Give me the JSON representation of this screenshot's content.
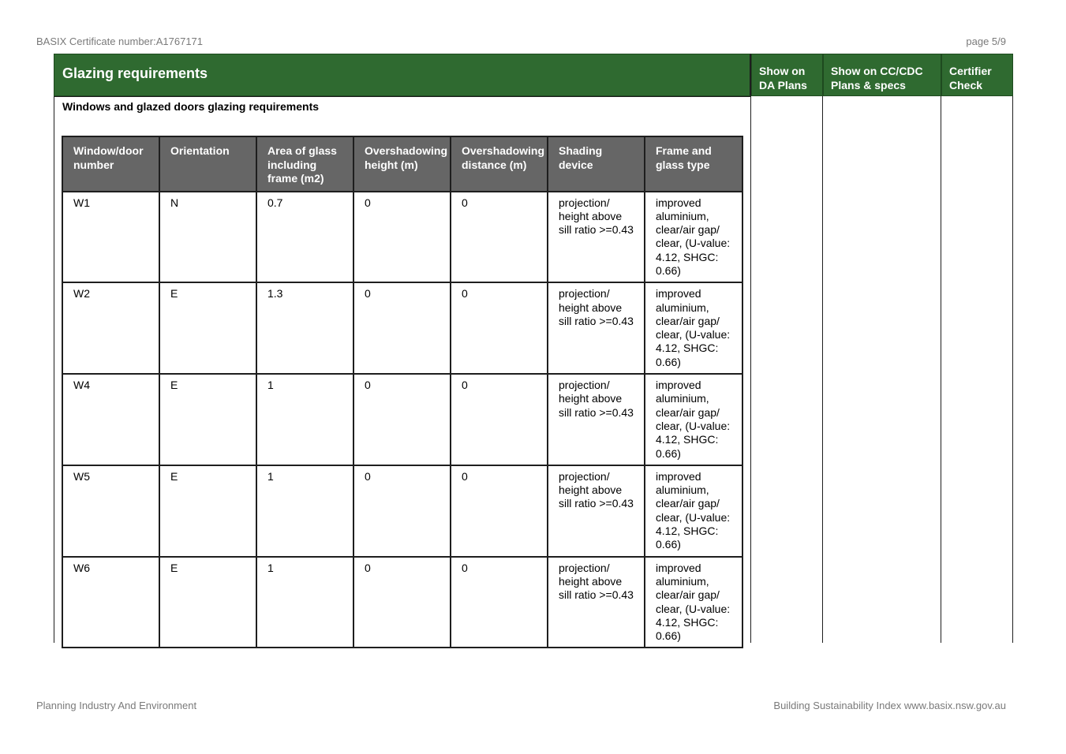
{
  "header": {
    "certificate": "BASIX Certificate number:A1767171",
    "page": "page 5/9"
  },
  "section": {
    "title": "Glazing requirements",
    "columns": [
      "Show on\nDA Plans",
      "Show on CC/CDC\nPlans & specs",
      "Certifier\nCheck"
    ],
    "subtitle": "Windows and glazed doors glazing requirements"
  },
  "table": {
    "headers": [
      "Window/door number",
      "Orientation",
      "Area of glass including frame (m2)",
      "Overshadowing height (m)",
      "Overshadowing distance (m)",
      "Shading device",
      "Frame and glass type"
    ],
    "rows": [
      [
        "W1",
        "N",
        "0.7",
        "0",
        "0",
        "projection/ height above sill ratio >=0.43",
        "improved aluminium, clear/air gap/ clear, (U-value: 4.12, SHGC: 0.66)"
      ],
      [
        "W2",
        "E",
        "1.3",
        "0",
        "0",
        "projection/ height above sill ratio >=0.43",
        "improved aluminium, clear/air gap/ clear, (U-value: 4.12, SHGC: 0.66)"
      ],
      [
        "W4",
        "E",
        "1",
        "0",
        "0",
        "projection/ height above sill ratio >=0.43",
        "improved aluminium, clear/air gap/ clear, (U-value: 4.12, SHGC: 0.66)"
      ],
      [
        "W5",
        "E",
        "1",
        "0",
        "0",
        "projection/ height above sill ratio >=0.43",
        "improved aluminium, clear/air gap/ clear, (U-value: 4.12, SHGC: 0.66)"
      ],
      [
        "W6",
        "E",
        "1",
        "0",
        "0",
        "projection/ height above sill ratio >=0.43",
        "improved aluminium, clear/air gap/ clear, (U-value: 4.12, SHGC: 0.66)"
      ]
    ]
  },
  "footer": {
    "left": "Planning Industry And Environment",
    "right": "Building Sustainability Index www.basix.nsw.gov.au"
  }
}
